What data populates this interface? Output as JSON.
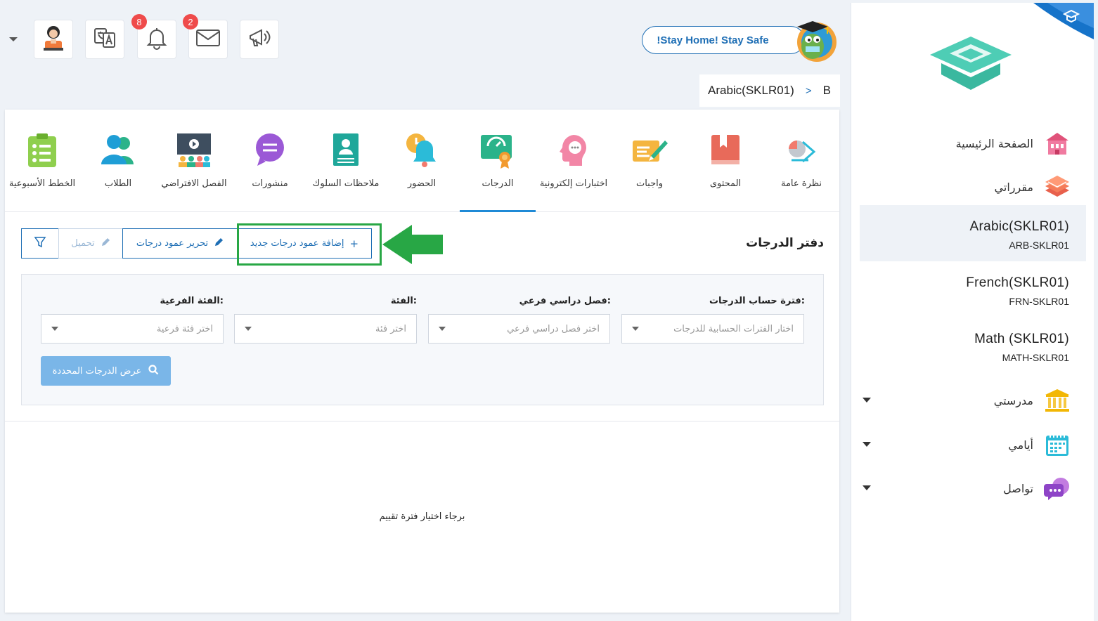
{
  "topbar": {
    "badges": {
      "notifications": "8",
      "messages": "2"
    },
    "stay_home": "!Stay Home! Stay Safe",
    "breadcrumb": {
      "course": "Arabic(SKLR01)",
      "sep": ">",
      "current": "B"
    }
  },
  "sidebar": {
    "home": "الصفحة الرئيسية",
    "courses": "مقرراتي",
    "course_list": [
      {
        "name": "Arabic(SKLR01)",
        "code": "ARB-SKLR01"
      },
      {
        "name": "French(SKLR01)",
        "code": "FRN-SKLR01"
      },
      {
        "name": "Math (SKLR01)",
        "code": "MATH-SKLR01"
      }
    ],
    "school": "مدرستي",
    "days": "أيامي",
    "communication": "تواصل"
  },
  "tabs": [
    {
      "label": "نظرة عامة",
      "icon": "overview-icon"
    },
    {
      "label": "المحتوى",
      "icon": "content-icon"
    },
    {
      "label": "واجبات",
      "icon": "assignments-icon"
    },
    {
      "label": "اختبارات إلكترونية",
      "icon": "quizzes-icon"
    },
    {
      "label": "الدرجات",
      "icon": "grades-icon"
    },
    {
      "label": "الحضور",
      "icon": "attendance-icon"
    },
    {
      "label": "ملاحظات السلوك",
      "icon": "behavior-icon"
    },
    {
      "label": "منشورات",
      "icon": "posts-icon"
    },
    {
      "label": "الفصل الافتراضي",
      "icon": "virtual-class-icon"
    },
    {
      "label": "الطلاب",
      "icon": "students-icon"
    },
    {
      "label": "الخطط الأسبوعية",
      "icon": "weekly-plans-icon"
    }
  ],
  "gradebook": {
    "title": "دفتر الدرجات",
    "add_column": "إضافة عمود درجات جديد",
    "edit_column": "تحرير عمود درجات",
    "upload": "تحميل",
    "filters": {
      "period_label": "فترة حساب الدرجات:",
      "period_placeholder": "اختار الفترات الحسابية للدرجات",
      "subterm_label": "فصل دراسي فرعي:",
      "subterm_placeholder": "اختر فصل دراسي فرعي",
      "category_label": "الفئة:",
      "category_placeholder": "اختر فئة",
      "subcategory_label": "الفئة الفرعية:",
      "subcategory_placeholder": "اختر فئة فرعية"
    },
    "show_button": "عرض الدرجات المحددة",
    "empty_message": "برجاء اختيار فترة تقييم"
  },
  "colors": {
    "primary": "#1f6fb5",
    "highlight": "#28a745",
    "active_tab": "#1f8ad6"
  }
}
